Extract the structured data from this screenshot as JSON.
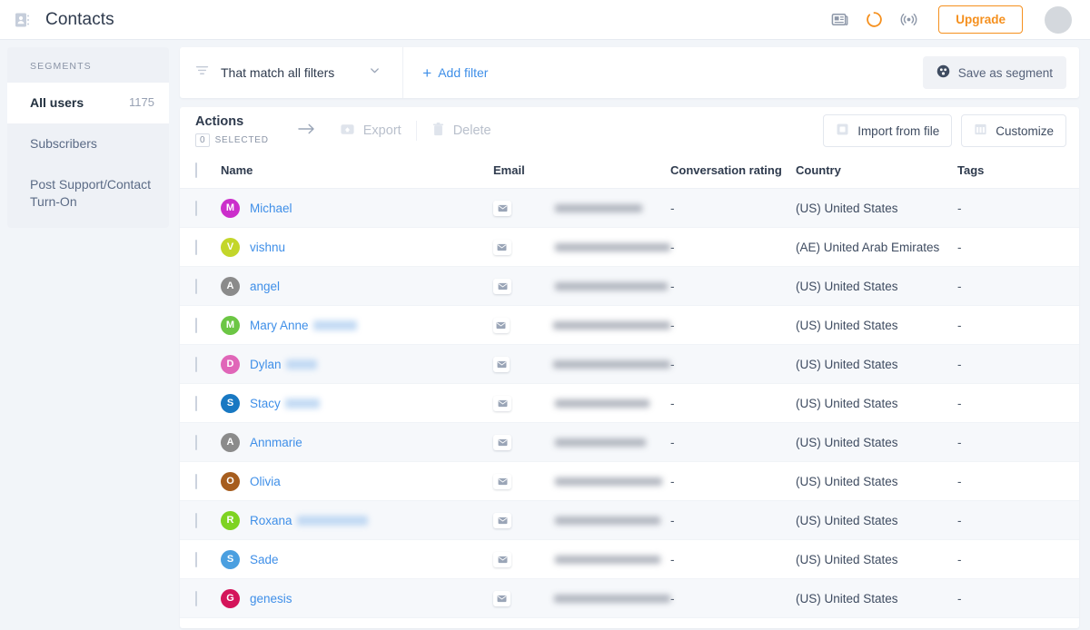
{
  "header": {
    "title": "Contacts",
    "app_icon": "contacts-book-icon",
    "icons": [
      {
        "name": "news-icon",
        "color": "#8d97a8"
      },
      {
        "name": "progress-circle-icon",
        "color": "#f5901e"
      },
      {
        "name": "broadcast-icon",
        "color": "#8d97a8"
      }
    ],
    "upgrade_label": "Upgrade",
    "accent_orange": "#f5901e",
    "avatar": "user-avatar"
  },
  "sidebar": {
    "section_label": "SEGMENTS",
    "items": [
      {
        "label": "All users",
        "count": "1175",
        "active": true
      },
      {
        "label": "Subscribers",
        "count": "",
        "active": false
      },
      {
        "label": "Post Support/Contact Turn-On",
        "count": "",
        "active": false
      }
    ]
  },
  "filter_bar": {
    "filter_icon": "filter-icon",
    "mode_label": "That match all filters",
    "add_filter_label": "Add filter",
    "add_filter_plus": "+",
    "save_segment_label": "Save as segment",
    "link_color": "#3f8fe8"
  },
  "actions_bar": {
    "title": "Actions",
    "selected_count": "0",
    "selected_label": "SELECTED",
    "export_label": "Export",
    "delete_label": "Delete",
    "import_label": "Import from file",
    "customize_label": "Customize"
  },
  "table": {
    "columns": [
      "Name",
      "Email",
      "Conversation rating",
      "Country",
      "Tags"
    ],
    "rows": [
      {
        "initial": "M",
        "color": "#cb2ecb",
        "first_name": "Michael",
        "last_name_blur": 0,
        "email_blur": 96,
        "rating": "-",
        "country": "(US) United States",
        "tags": "-"
      },
      {
        "initial": "V",
        "color": "#c3d62b",
        "first_name": "vishnu",
        "last_name_blur": 0,
        "email_blur": 128,
        "rating": "-",
        "country": "(AE) United Arab Emirates",
        "tags": "-"
      },
      {
        "initial": "A",
        "color": "#8b8b8b",
        "first_name": "angel",
        "last_name_blur": 0,
        "email_blur": 124,
        "rating": "-",
        "country": "(US) United States",
        "tags": "-"
      },
      {
        "initial": "M",
        "color": "#6cc644",
        "first_name": "Mary Anne",
        "last_name_blur": 48,
        "email_blur": 148,
        "rating": "-",
        "country": "(US) United States",
        "tags": "-"
      },
      {
        "initial": "D",
        "color": "#e066b8",
        "first_name": "Dylan",
        "last_name_blur": 34,
        "email_blur": 142,
        "rating": "-",
        "country": "(US) United States",
        "tags": "-"
      },
      {
        "initial": "S",
        "color": "#1878c2",
        "first_name": "Stacy",
        "last_name_blur": 38,
        "email_blur": 104,
        "rating": "-",
        "country": "(US) United States",
        "tags": "-"
      },
      {
        "initial": "A",
        "color": "#8b8b8b",
        "first_name": "Annmarie",
        "last_name_blur": 0,
        "email_blur": 100,
        "rating": "-",
        "country": "(US) United States",
        "tags": "-"
      },
      {
        "initial": "O",
        "color": "#a65d1e",
        "first_name": "Olivia",
        "last_name_blur": 0,
        "email_blur": 118,
        "rating": "-",
        "country": "(US) United States",
        "tags": "-"
      },
      {
        "initial": "R",
        "color": "#7ed321",
        "first_name": "Roxana",
        "last_name_blur": 78,
        "email_blur": 116,
        "rating": "-",
        "country": "(US) United States",
        "tags": "-"
      },
      {
        "initial": "S",
        "color": "#4a9fe0",
        "first_name": "Sade",
        "last_name_blur": 0,
        "email_blur": 116,
        "rating": "-",
        "country": "(US) United States",
        "tags": "-"
      },
      {
        "initial": "G",
        "color": "#d4145a",
        "first_name": "genesis",
        "last_name_blur": 0,
        "email_blur": 138,
        "rating": "-",
        "country": "(US) United States",
        "tags": "-"
      }
    ]
  }
}
